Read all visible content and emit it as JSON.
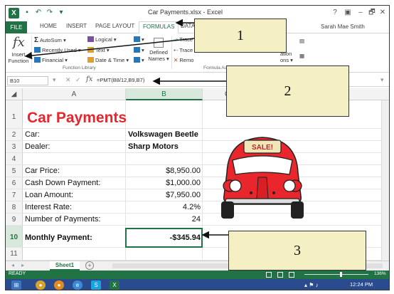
{
  "window": {
    "title": "Car Payments.xlsx - Excel",
    "user": "Sarah Mae Smith",
    "controls": [
      "?",
      "▣",
      "–",
      "🗗",
      "✕"
    ]
  },
  "tabs": {
    "file": "FILE",
    "home": "HOME",
    "insert": "INSERT",
    "page_layout": "PAGE LAYOUT",
    "formulas": "FORMULAS",
    "data": "DATA"
  },
  "ribbon": {
    "insert_function_line1": "Insert",
    "insert_function_line2": "Function",
    "autosum": "AutoSum",
    "recently_used": "Recently Used",
    "financial": "Financial",
    "logical": "Logical",
    "text": "Text",
    "date_time": "Date & Time",
    "defined_line1": "Defined",
    "defined_line2": "Names",
    "trace_precedents": "Trace",
    "trace_dependents": "Trace",
    "remove": "Remo",
    "calculation_line1": "ation",
    "calculation_line2": "ons",
    "function_library_label": "Function Library",
    "formula_auditing_label": "Formula Aud"
  },
  "formula_bar": {
    "cell_ref": "B10",
    "formula": "=PMT(B8/12,B9,B7)"
  },
  "columns": [
    "A",
    "B",
    "C"
  ],
  "rows": [
    {
      "num": "1",
      "a": "Car Payments",
      "b": ""
    },
    {
      "num": "2",
      "a": "Car:",
      "b": "Volkswagen Beetle"
    },
    {
      "num": "3",
      "a": "Dealer:",
      "b": "Sharp Motors"
    },
    {
      "num": "4",
      "a": "",
      "b": ""
    },
    {
      "num": "5",
      "a": "Car Price:",
      "b": "$8,950.00"
    },
    {
      "num": "6",
      "a": "Cash Down Payment:",
      "b": "$1,000.00"
    },
    {
      "num": "7",
      "a": "Loan Amount:",
      "b": "$7,950.00"
    },
    {
      "num": "8",
      "a": "Interest Rate:",
      "b": "4.2%"
    },
    {
      "num": "9",
      "a": "Number of Payments:",
      "b": "24"
    },
    {
      "num": "10",
      "a": "Monthly Payment:",
      "b": "-$345.94"
    },
    {
      "num": "11",
      "a": "",
      "b": ""
    }
  ],
  "car_sign": "SALE!",
  "sheet_tab": "Sheet1",
  "status": {
    "ready": "READY",
    "zoom": "136%"
  },
  "taskbar": {
    "clock": "12:24 PM"
  },
  "callouts": [
    "1",
    "2",
    "3"
  ],
  "colors": {
    "excel_green": "#217346",
    "title_red": "#e6262e",
    "callout_fill": "#f5f0c3",
    "car_red": "#e8262b",
    "taskbar_blue": "#2a4b8d"
  }
}
